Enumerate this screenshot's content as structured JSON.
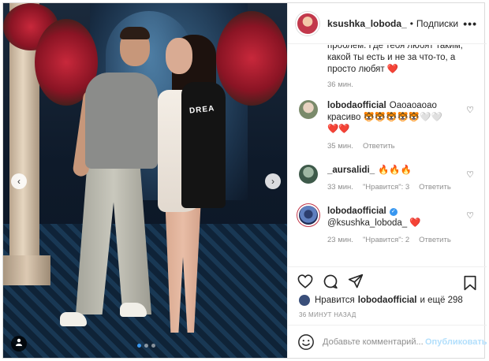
{
  "post": {
    "username": "ksushka_loboda_",
    "separator": "•",
    "follow_status": "Подписки",
    "more": "•••"
  },
  "caption": {
    "text": "проблем. Где тебя любят таким, какой ты есть и не за что-то, а просто любят",
    "time": "36 мин."
  },
  "comments": [
    {
      "username": "lobodaofficial",
      "text": "Оаоаоаоао",
      "text_line2": "красиво 🐯🐯🐯🐯🐯🤍🤍",
      "hearts": "❤️❤️",
      "time": "35 мин.",
      "reply": "Ответить",
      "likes": ""
    },
    {
      "username": "_aursalidi_",
      "text": "🔥🔥🔥",
      "time": "33 мин.",
      "likes": "\"Нравится\": 3",
      "reply": "Ответить"
    },
    {
      "username": "lobodaofficial",
      "mention": "@ksushka_loboda_",
      "time": "23 мин.",
      "likes": "\"Нравится\": 2",
      "reply": "Ответить"
    }
  ],
  "likes": {
    "prefix": "Нравится",
    "user": "lobodaofficial",
    "suffix": "и ещё 298"
  },
  "timestamp": "36 МИНУТ НАЗАД",
  "add_comment": {
    "placeholder": "Добавьте комментарий...",
    "publish": "Опубликовать"
  },
  "photo": {
    "jacket_text": "DREA",
    "carousel_count": 3,
    "carousel_active": 1
  },
  "colors": {
    "accent": "#3897f0",
    "heart": "#ed4956",
    "muted": "#8e8e8e"
  }
}
